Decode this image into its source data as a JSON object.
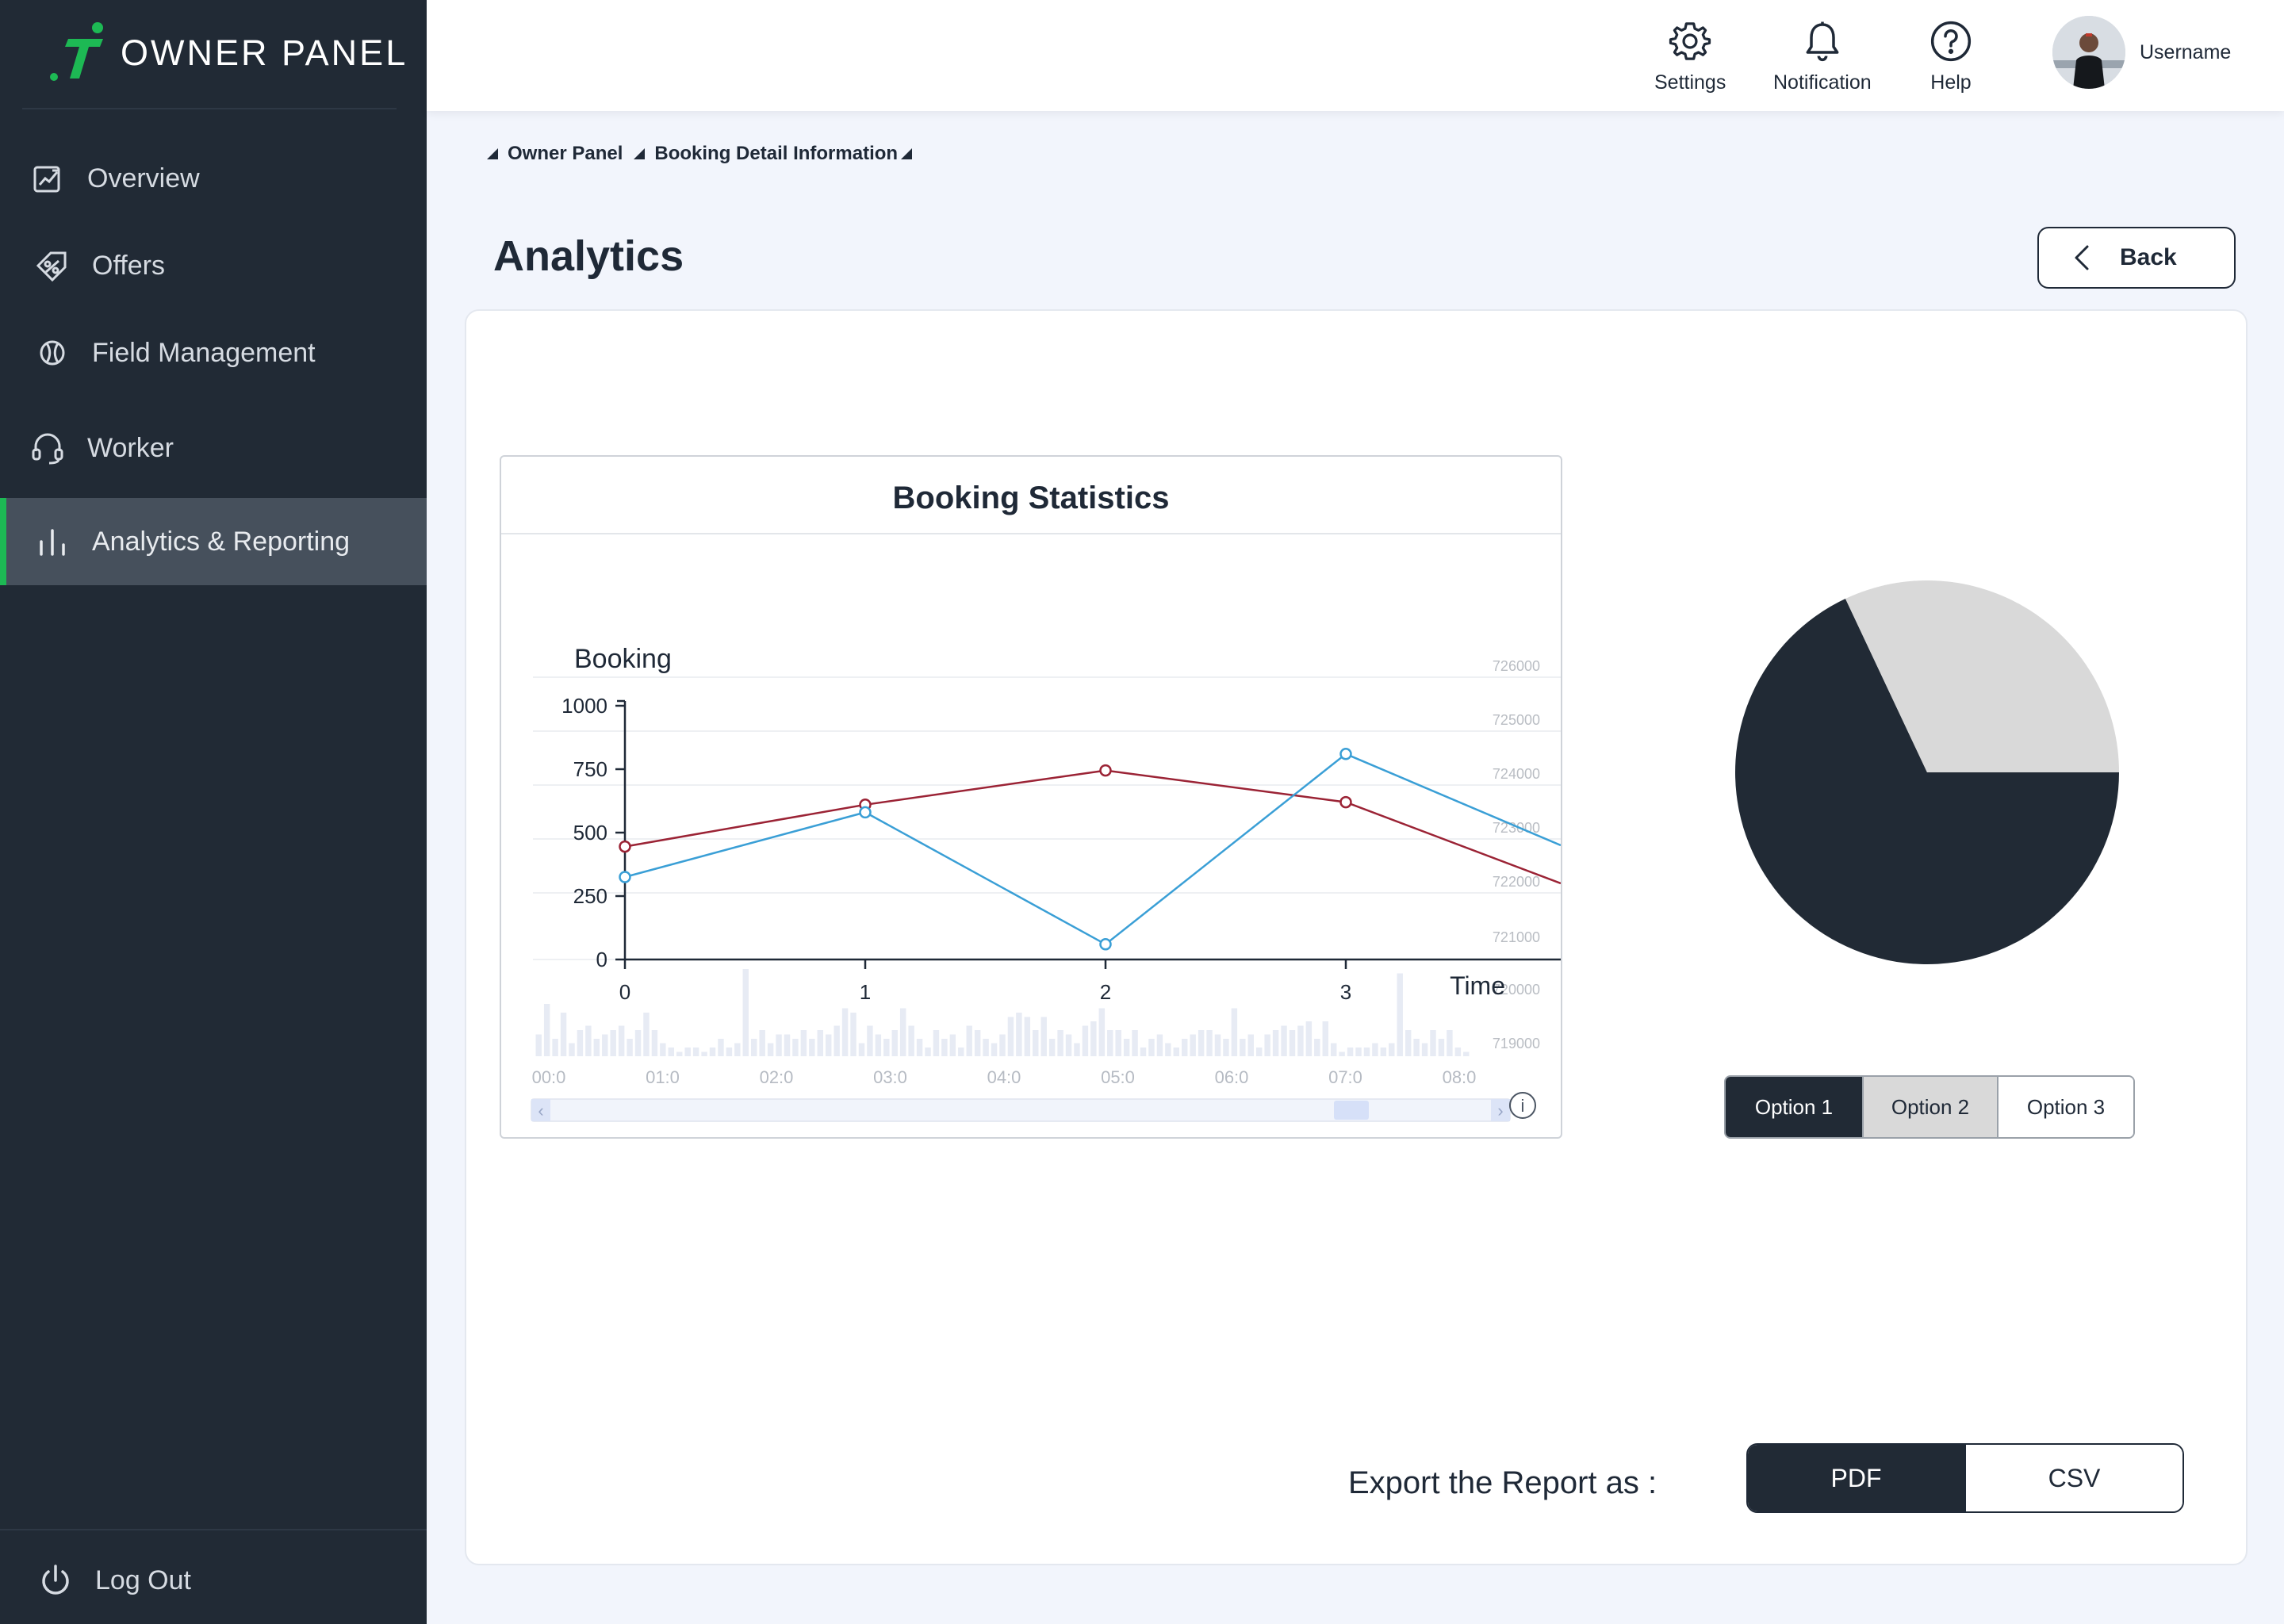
{
  "sidebar": {
    "logo_text": "OWNER PANEL",
    "items": [
      {
        "label": "Overview",
        "icon": "trend-chart-icon"
      },
      {
        "label": "Offers",
        "icon": "tag-icon"
      },
      {
        "label": "Field Management",
        "icon": "ball-icon"
      },
      {
        "label": "Worker",
        "icon": "headset-icon"
      },
      {
        "label": "Analytics & Reporting",
        "icon": "bar-chart-icon",
        "active": true
      }
    ],
    "logout_label": "Log Out",
    "accent_color": "#1db954"
  },
  "header": {
    "settings_label": "Settings",
    "notification_label": "Notification",
    "help_label": "Help",
    "username": "Username"
  },
  "breadcrumb": {
    "items": [
      "Owner Panel",
      "Booking Detail Information"
    ]
  },
  "page": {
    "title": "Analytics",
    "back_label": "Back"
  },
  "chart_data": {
    "type": "line",
    "title": "Booking Statistics",
    "ylabel": "Booking",
    "xlabel": "Time",
    "x": [
      0,
      1,
      2,
      3
    ],
    "x_ticks": [
      "0",
      "1",
      "2",
      "3"
    ],
    "y_ticks": [
      "0",
      "250",
      "500",
      "750",
      "1000"
    ],
    "ylim": [
      0,
      1000
    ],
    "series": [
      {
        "color": "#9b2335",
        "values": [
          445,
          610,
          745,
          620
        ],
        "trailing_value": 300
      },
      {
        "color": "#3a9fd6",
        "values": [
          325,
          580,
          60,
          810
        ],
        "trailing_value": 450
      }
    ],
    "secondary_y_ticks": [
      "726000",
      "725000",
      "724000",
      "723000",
      "722000",
      "721000",
      "720000",
      "719000"
    ],
    "minimap_time_ticks": [
      "00:0",
      "01:0",
      "02:0",
      "03:0",
      "04:0",
      "05:0",
      "06:0",
      "07:0",
      "08:0"
    ],
    "minimap_bars": [
      0.25,
      0.6,
      0.2,
      0.5,
      0.15,
      0.3,
      0.35,
      0.2,
      0.25,
      0.3,
      0.35,
      0.2,
      0.3,
      0.5,
      0.3,
      0.15,
      0.1,
      0.05,
      0.1,
      0.1,
      0.05,
      0.1,
      0.2,
      0.1,
      0.15,
      1.0,
      0.2,
      0.3,
      0.15,
      0.25,
      0.25,
      0.2,
      0.3,
      0.2,
      0.3,
      0.25,
      0.35,
      0.55,
      0.5,
      0.15,
      0.35,
      0.25,
      0.2,
      0.3,
      0.55,
      0.35,
      0.2,
      0.1,
      0.3,
      0.2,
      0.25,
      0.1,
      0.35,
      0.3,
      0.2,
      0.15,
      0.25,
      0.45,
      0.5,
      0.45,
      0.3,
      0.45,
      0.2,
      0.3,
      0.25,
      0.15,
      0.35,
      0.4,
      0.55,
      0.3,
      0.3,
      0.2,
      0.3,
      0.1,
      0.2,
      0.25,
      0.15,
      0.1,
      0.2,
      0.25,
      0.3,
      0.3,
      0.25,
      0.2,
      0.55,
      0.2,
      0.25,
      0.1,
      0.25,
      0.3,
      0.35,
      0.3,
      0.35,
      0.4,
      0.2,
      0.4,
      0.15,
      0.05,
      0.1,
      0.1,
      0.1,
      0.15,
      0.1,
      0.15,
      0.95,
      0.3,
      0.2,
      0.15,
      0.3,
      0.2,
      0.3,
      0.1,
      0.05
    ]
  },
  "pie_data": {
    "type": "pie",
    "slices": [
      {
        "value": 0.68,
        "color": "#212a35"
      },
      {
        "value": 0.32,
        "color": "#d9d9d9"
      }
    ]
  },
  "pie_options": [
    {
      "label": "Option 1",
      "state": "selected"
    },
    {
      "label": "Option 2",
      "state": "hover"
    },
    {
      "label": "Option 3",
      "state": "normal"
    }
  ],
  "export": {
    "label": "Export the Report as :",
    "pdf_label": "PDF",
    "csv_label": "CSV"
  }
}
